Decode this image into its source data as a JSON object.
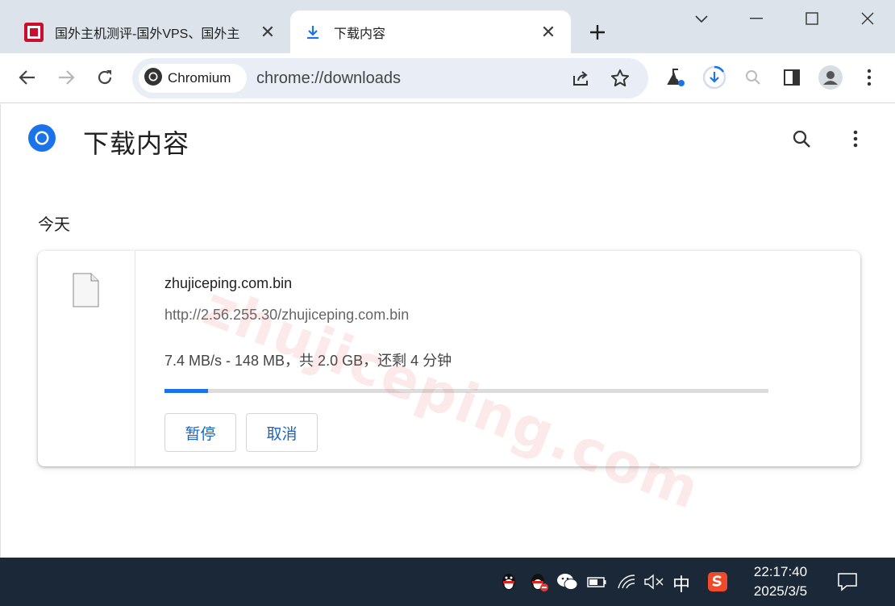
{
  "browser": {
    "tabs": [
      {
        "title": "国外主机测评-国外VPS、国外主",
        "active": false
      },
      {
        "title": "下载内容",
        "active": true
      }
    ],
    "address": {
      "chip_label": "Chromium",
      "url": "chrome://downloads"
    }
  },
  "page": {
    "title": "下载内容",
    "section_label": "今天",
    "watermark": "zhujiceping.com"
  },
  "download": {
    "file_name": "zhujiceping.com.bin",
    "source_url": "http://2.56.255.30/zhujiceping.com.bin",
    "status": "7.4 MB/s - 148 MB，共 2.0 GB，还剩 4 分钟",
    "progress_fraction": 0.072,
    "pause_label": "暂停",
    "cancel_label": "取消"
  },
  "taskbar": {
    "ime": "中",
    "time": "22:17:40",
    "date": "2025/3/5"
  },
  "colors": {
    "accent": "#1a73e8",
    "tabbar": "#dde3ea",
    "taskbar": "#1b2838"
  }
}
